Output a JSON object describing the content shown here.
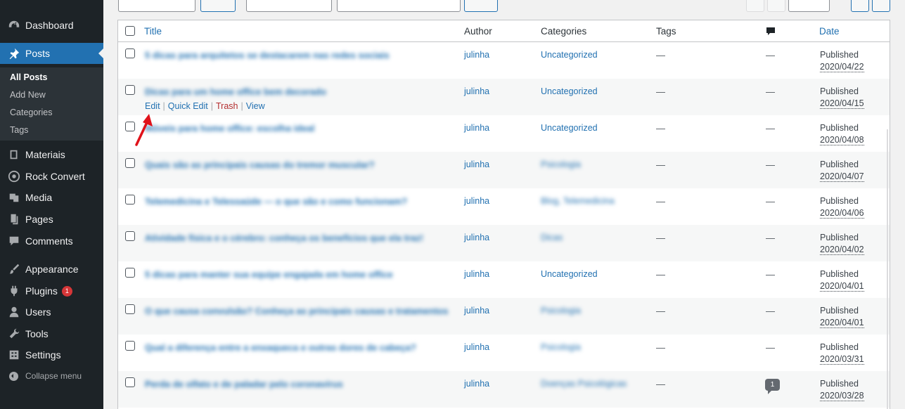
{
  "sidebar": {
    "items": [
      {
        "label": "Dashboard",
        "icon": "dashboard-icon"
      },
      {
        "label": "Posts",
        "icon": "pin-icon"
      },
      {
        "label": "Materiais",
        "icon": "book-icon"
      },
      {
        "label": "Rock Convert",
        "icon": "target-icon"
      },
      {
        "label": "Media",
        "icon": "media-icon"
      },
      {
        "label": "Pages",
        "icon": "pages-icon"
      },
      {
        "label": "Comments",
        "icon": "comment-icon"
      },
      {
        "label": "Appearance",
        "icon": "brush-icon"
      },
      {
        "label": "Plugins",
        "icon": "plug-icon",
        "badge": "1"
      },
      {
        "label": "Users",
        "icon": "user-icon"
      },
      {
        "label": "Tools",
        "icon": "wrench-icon"
      },
      {
        "label": "Settings",
        "icon": "settings-icon"
      }
    ],
    "submenu": [
      "All Posts",
      "Add New",
      "Categories",
      "Tags"
    ],
    "collapse_label": "Collapse menu"
  },
  "table": {
    "headers": {
      "title": "Title",
      "author": "Author",
      "categories": "Categories",
      "tags": "Tags",
      "date": "Date"
    },
    "row_actions": {
      "edit": "Edit",
      "quick_edit": "Quick Edit",
      "trash": "Trash",
      "view": "View"
    },
    "rows": [
      {
        "title": "5 dicas para arquitetos se destacarem nas redes sociais",
        "author": "julinha",
        "category": "Uncategorized",
        "category_blurred": false,
        "tags": "—",
        "comments": "—",
        "status": "Published",
        "date": "2020/04/22"
      },
      {
        "title": "Dicas para um home office bem decorado",
        "author": "julinha",
        "category": "Uncategorized",
        "category_blurred": false,
        "tags": "—",
        "comments": "—",
        "status": "Published",
        "date": "2020/04/15"
      },
      {
        "title": "Móveis para home office: escolha ideal",
        "author": "julinha",
        "category": "Uncategorized",
        "category_blurred": false,
        "tags": "—",
        "comments": "—",
        "status": "Published",
        "date": "2020/04/08"
      },
      {
        "title": "Quais são as principais causas do tremor muscular?",
        "author": "julinha",
        "category": "Psicologia",
        "category_blurred": true,
        "tags": "—",
        "comments": "—",
        "status": "Published",
        "date": "2020/04/07"
      },
      {
        "title": "Telemedicina e Telessaúde — o que são e como funcionam?",
        "author": "julinha",
        "category": "Blog, Telemedicina",
        "category_blurred": true,
        "tags": "—",
        "comments": "—",
        "status": "Published",
        "date": "2020/04/06"
      },
      {
        "title": "Atividade física e o cérebro: conheça os benefícios que ela traz!",
        "author": "julinha",
        "category": "Dicas",
        "category_blurred": true,
        "tags": "—",
        "comments": "—",
        "status": "Published",
        "date": "2020/04/02"
      },
      {
        "title": "5 dicas para manter sua equipe engajada em home office",
        "author": "julinha",
        "category": "Uncategorized",
        "category_blurred": false,
        "tags": "—",
        "comments": "—",
        "status": "Published",
        "date": "2020/04/01"
      },
      {
        "title": "O que causa convulsão? Conheça as principais causas e tratamentos",
        "author": "julinha",
        "category": "Psicologia",
        "category_blurred": true,
        "tags": "—",
        "comments": "—",
        "status": "Published",
        "date": "2020/04/01"
      },
      {
        "title": "Qual a diferença entre a enxaqueca e outras dores de cabeça?",
        "author": "julinha",
        "category": "Psicologia",
        "category_blurred": true,
        "tags": "—",
        "comments": "—",
        "status": "Published",
        "date": "2020/03/31"
      },
      {
        "title": "Perda de olfato e de paladar pelo coronavírus",
        "author": "julinha",
        "category": "Doenças Psicológicas",
        "category_blurred": true,
        "tags": "—",
        "comments": "1",
        "status": "Published",
        "date": "2020/03/28"
      }
    ]
  },
  "colors": {
    "accent": "#2271b1",
    "sidebar": "#1d2327",
    "trash": "#b32d2e",
    "annotation_arrow": "#e0121a"
  }
}
